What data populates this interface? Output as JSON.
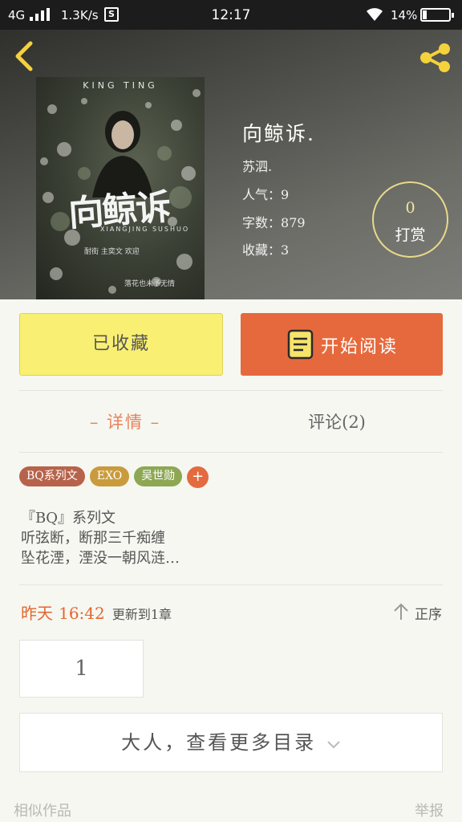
{
  "status_bar": {
    "network": "4G",
    "speed": "1.3K/s",
    "sim_label": "S",
    "time": "12:17",
    "battery_percent": "14%",
    "battery_level": 0.14
  },
  "book": {
    "cover": {
      "brand": "KING TING",
      "title": "向鲸诉",
      "subtitle": "XIANGJING SUSHUO",
      "note": "耐街 主奕文 欢迎",
      "footer": "落花也未予无情"
    },
    "title": "向鲸诉.",
    "author": "苏泗.",
    "popularity_label": "人气：",
    "popularity": "9",
    "words_label": "字数：",
    "words": "879",
    "favorites_label": "收藏：",
    "favorites": "3"
  },
  "tip": {
    "count": "0",
    "label": "打赏"
  },
  "actions": {
    "collected": "已收藏",
    "start_reading": "开始阅读"
  },
  "tabs": {
    "detail": "– 详情 –",
    "comments": "评论(2)"
  },
  "tags": [
    {
      "label": "BQ系列文",
      "color": "#b7634b"
    },
    {
      "label": "EXO",
      "color": "#c99b3d"
    },
    {
      "label": "吴世勋",
      "color": "#8ea754"
    }
  ],
  "tag_add": "+",
  "intro": "『BQ』系列文\n听弦断，断那三千痴缠\n坠花湮，湮没一朝风涟…",
  "update": {
    "day": "昨天",
    "time": "16:42",
    "text": "更新到1章"
  },
  "sort_label": "正序",
  "chapter_page": "1",
  "more_catalog": "大人，查看更多目录",
  "footer": {
    "similar": "相似作品",
    "report": "举报"
  }
}
